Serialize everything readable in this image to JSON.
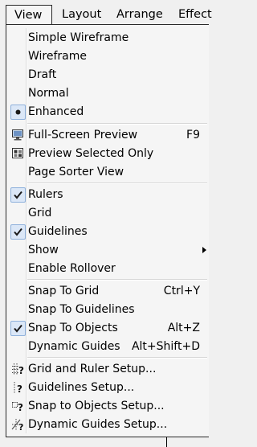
{
  "menubar": {
    "items": [
      {
        "label": "View"
      },
      {
        "label": "Layout"
      },
      {
        "label": "Arrange"
      },
      {
        "label": "Effect"
      }
    ]
  },
  "menu": {
    "items": [
      {
        "label": "Simple Wireframe",
        "shortcut": "",
        "icon": ""
      },
      {
        "label": "Wireframe",
        "shortcut": "",
        "icon": ""
      },
      {
        "label": "Draft",
        "shortcut": "",
        "icon": ""
      },
      {
        "label": "Normal",
        "shortcut": "",
        "icon": ""
      },
      {
        "label": "Enhanced",
        "shortcut": "",
        "icon": "radio-selected-icon"
      },
      {
        "label": "Full-Screen Preview",
        "shortcut": "F9",
        "icon": "monitor-icon"
      },
      {
        "label": "Preview Selected Only",
        "shortcut": "",
        "icon": "preview-selected-icon"
      },
      {
        "label": "Page Sorter View",
        "shortcut": "",
        "icon": ""
      },
      {
        "label": "Rulers",
        "shortcut": "",
        "icon": "checkmark-icon"
      },
      {
        "label": "Grid",
        "shortcut": "",
        "icon": ""
      },
      {
        "label": "Guidelines",
        "shortcut": "",
        "icon": "checkmark-icon"
      },
      {
        "label": "Show",
        "shortcut": "",
        "icon": ""
      },
      {
        "label": "Enable Rollover",
        "shortcut": "",
        "icon": ""
      },
      {
        "label": "Snap To Grid",
        "shortcut": "Ctrl+Y",
        "icon": ""
      },
      {
        "label": "Snap To Guidelines",
        "shortcut": "",
        "icon": ""
      },
      {
        "label": "Snap To Objects",
        "shortcut": "Alt+Z",
        "icon": "checkmark-icon"
      },
      {
        "label": "Dynamic Guides",
        "shortcut": "Alt+Shift+D",
        "icon": ""
      },
      {
        "label": "Grid and Ruler Setup...",
        "shortcut": "",
        "icon": "grid-setup-icon"
      },
      {
        "label": "Guidelines Setup...",
        "shortcut": "",
        "icon": "guidelines-setup-icon"
      },
      {
        "label": "Snap to Objects Setup...",
        "shortcut": "",
        "icon": "snap-setup-icon"
      },
      {
        "label": "Dynamic Guides Setup...",
        "shortcut": "",
        "icon": "dynamic-guides-setup-icon"
      }
    ]
  }
}
